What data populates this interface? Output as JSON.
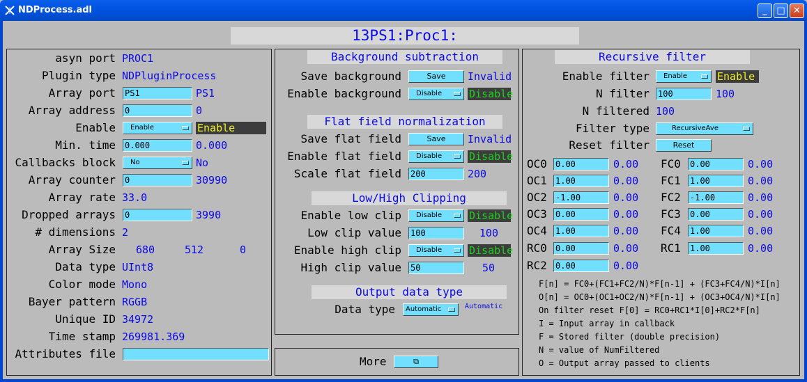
{
  "window": {
    "title": "NDProcess.adl"
  },
  "header": {
    "prefix": "13PS1:Proc1:"
  },
  "left": {
    "asyn_port": {
      "label": "asyn port",
      "value": "PROC1"
    },
    "plugin_type": {
      "label": "Plugin type",
      "value": "NDPluginProcess"
    },
    "array_port": {
      "label": "Array port",
      "input": "PS1",
      "readback": "PS1"
    },
    "array_address": {
      "label": "Array address",
      "input": "0",
      "readback": "0"
    },
    "enable": {
      "label": "Enable",
      "menu": "Enable",
      "readback": "Enable"
    },
    "min_time": {
      "label": "Min. time",
      "input": "0.000",
      "readback": "0.000"
    },
    "callbacks_block": {
      "label": "Callbacks block",
      "menu": "No",
      "readback": "No"
    },
    "array_counter": {
      "label": "Array counter",
      "input": "0",
      "readback": "30990"
    },
    "array_rate": {
      "label": "Array rate",
      "value": "33.0"
    },
    "dropped_arrays": {
      "label": "Dropped arrays",
      "input": "0",
      "readback": "3990"
    },
    "dimensions": {
      "label": "# dimensions",
      "value": "2"
    },
    "array_size": {
      "label": "Array Size",
      "x": "680",
      "y": "512",
      "z": "0"
    },
    "data_type": {
      "label": "Data type",
      "value": "UInt8"
    },
    "color_mode": {
      "label": "Color mode",
      "value": "Mono"
    },
    "bayer_pattern": {
      "label": "Bayer pattern",
      "value": "RGGB"
    },
    "unique_id": {
      "label": "Unique ID",
      "value": "34972"
    },
    "time_stamp": {
      "label": "Time stamp",
      "value": "269981.369"
    },
    "attributes_file": {
      "label": "Attributes file",
      "input": ""
    }
  },
  "middle": {
    "bg_title": "Background subtraction",
    "save_background": {
      "label": "Save background",
      "button": "Save",
      "status": "Invalid"
    },
    "enable_background": {
      "label": "Enable background",
      "menu": "Disable",
      "status": "Disable"
    },
    "ff_title": "Flat field normalization",
    "save_flat": {
      "label": "Save flat field",
      "button": "Save",
      "status": "Invalid"
    },
    "enable_flat": {
      "label": "Enable flat field",
      "menu": "Disable",
      "status": "Disable"
    },
    "scale_flat": {
      "label": "Scale flat field",
      "input": "200",
      "readback": "200"
    },
    "clip_title": "Low/High Clipping",
    "enable_low": {
      "label": "Enable low clip",
      "menu": "Disable",
      "status": "Disable"
    },
    "low_value": {
      "label": "Low clip value",
      "input": "100",
      "readback": "100"
    },
    "enable_high": {
      "label": "Enable high clip",
      "menu": "Disable",
      "status": "Disable"
    },
    "high_value": {
      "label": "High clip value",
      "input": "50",
      "readback": "50"
    },
    "out_title": "Output data type",
    "data_type": {
      "label": "Data type",
      "menu": "Automatic",
      "readback": "Automatic"
    },
    "more": {
      "label": "More",
      "icon": "related-display-icon"
    }
  },
  "right": {
    "title": "Recursive filter",
    "enable_filter": {
      "label": "Enable filter",
      "menu": "Enable",
      "status": "Enable"
    },
    "n_filter": {
      "label": "N filter",
      "input": "100",
      "readback": "100"
    },
    "n_filtered": {
      "label": "N filtered",
      "value": "100"
    },
    "filter_type": {
      "label": "Filter type",
      "menu": "RecursiveAve"
    },
    "reset_filter": {
      "label": "Reset filter",
      "button": "Reset"
    },
    "coeffs_left": [
      {
        "label": "OC0",
        "input": "0.00",
        "readback": "0.00"
      },
      {
        "label": "OC1",
        "input": "1.00",
        "readback": "0.00"
      },
      {
        "label": "OC2",
        "input": "-1.00",
        "readback": "0.00"
      },
      {
        "label": "OC3",
        "input": "0.00",
        "readback": "0.00"
      },
      {
        "label": "OC4",
        "input": "1.00",
        "readback": "0.00"
      },
      {
        "label": "RC0",
        "input": "0.00",
        "readback": "0.00"
      },
      {
        "label": "RC2",
        "input": "0.00",
        "readback": "0.00"
      }
    ],
    "coeffs_right": [
      {
        "label": "FC0",
        "input": "0.00",
        "readback": "0.00"
      },
      {
        "label": "FC1",
        "input": "1.00",
        "readback": "0.00"
      },
      {
        "label": "FC2",
        "input": "-1.00",
        "readback": "0.00"
      },
      {
        "label": "FC3",
        "input": "0.00",
        "readback": "0.00"
      },
      {
        "label": "FC4",
        "input": "1.00",
        "readback": "0.00"
      },
      {
        "label": "RC1",
        "input": "1.00",
        "readback": "0.00"
      }
    ],
    "help": [
      "F[n] = FC0+(FC1+FC2/N)*F[n-1] + (FC3+FC4/N)*I[n]",
      "O[n] = OC0+(OC1+OC2/N)*F[n-1] + (OC3+OC4/N)*I[n]",
      "On filter reset F[0] = RC0+RC1*I[0]+RC2*F[n]",
      "I = Input array in callback",
      "F = Stored filter (double precision)",
      "N = value of NumFiltered",
      "O = Output array passed to clients"
    ]
  },
  "colors": {
    "input_bg": "#73dfff",
    "readback": "#0a0ae6",
    "panel_bg": "#bbbbbb",
    "status_enable_fg": "#f0f028",
    "status_disable_fg": "#1fd21f",
    "status_box_bg": "#3c3c3c",
    "titlebar": "#0054e3"
  }
}
